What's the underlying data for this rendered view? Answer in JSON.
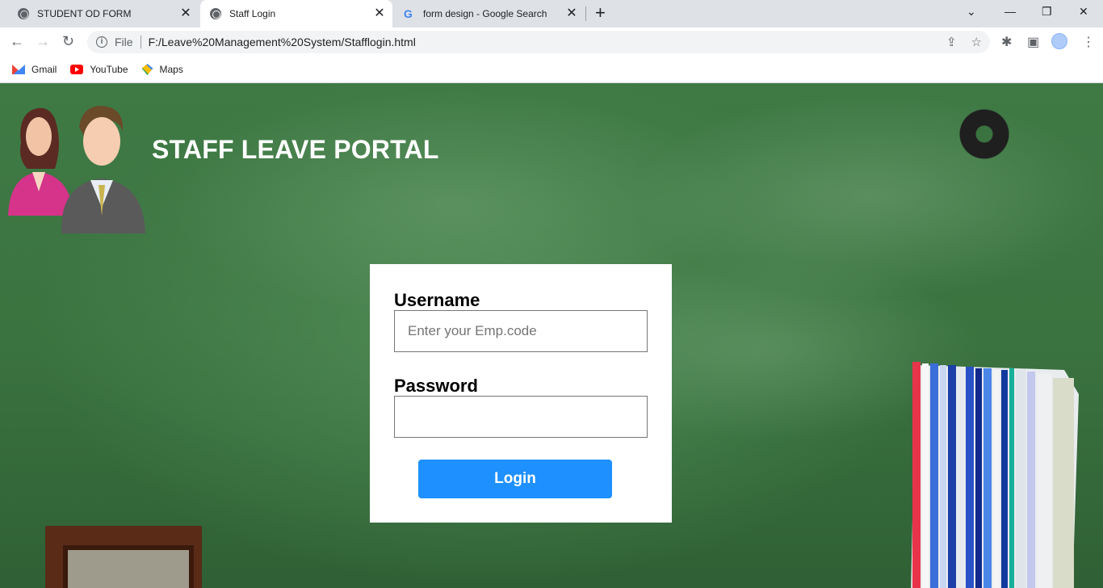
{
  "browser": {
    "tabs": [
      {
        "title": "STUDENT OD FORM",
        "active": false,
        "icon": "globe-icon"
      },
      {
        "title": "Staff Login",
        "active": true,
        "icon": "globe-icon"
      },
      {
        "title": "form design - Google Search",
        "active": false,
        "icon": "google-icon"
      }
    ],
    "address": {
      "scheme_label": "File",
      "url": "F:/Leave%20Management%20System/Stafflogin.html"
    },
    "bookmarks": [
      {
        "label": "Gmail",
        "icon": "gmail-icon"
      },
      {
        "label": "YouTube",
        "icon": "youtube-icon"
      },
      {
        "label": "Maps",
        "icon": "maps-icon"
      }
    ]
  },
  "page": {
    "title": "STAFF LEAVE PORTAL",
    "login": {
      "username_label": "Username",
      "username_placeholder": "Enter your Emp.code",
      "username_value": "",
      "password_label": "Password",
      "password_value": "",
      "submit_label": "Login"
    }
  },
  "colors": {
    "board_green": "#3f7a45",
    "button_blue": "#1e90ff",
    "title_white": "#ffffff"
  }
}
